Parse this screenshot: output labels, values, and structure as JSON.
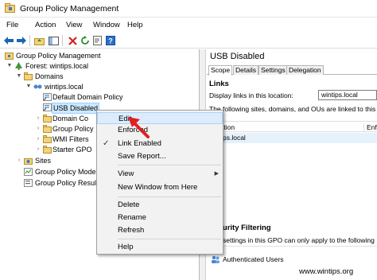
{
  "window": {
    "title": "Group Policy Management"
  },
  "menu": [
    "File",
    "Action",
    "View",
    "Window",
    "Help"
  ],
  "toolbar": {
    "icons": [
      "back-arrow-icon",
      "forward-arrow-icon",
      "up-folder-icon",
      "show-hide-tree-icon",
      "delete-x-icon",
      "refresh-icon",
      "export-icon",
      "help-icon"
    ]
  },
  "tree": {
    "root": "Group Policy Management",
    "forest": "Forest: wintips.local",
    "domains": "Domains",
    "domain": "wintips.local",
    "default_policy": "Default Domain Policy",
    "selected": "USB Disabled",
    "domain_controllers": "Domain Co",
    "group_policy_objects": "Group Policy",
    "wmi_filters": "WMI Filters",
    "starter_gpos": "Starter GPO",
    "sites": "Sites",
    "modeling": "Group Policy Modeli",
    "results": "Group Policy Resul"
  },
  "right": {
    "title": "USB Disabled",
    "tabs": [
      "Scope",
      "Details",
      "Settings",
      "Delegation"
    ],
    "links_heading": "Links",
    "display_links_label": "Display links in this location:",
    "location_value": "wintips.local",
    "linked_text": "The following sites, domains, and OUs are linked to this GPO:",
    "col_location": "Location",
    "col_enforced": "Enfo",
    "row_location": "wintips.local",
    "filter_heading": "Security Filtering",
    "filter_text": "The settings in this GPO can only apply to the following",
    "filter_row": "Authenticated Users"
  },
  "context_menu": {
    "items": {
      "edit": "Edit...",
      "enforced": "Enforced",
      "link_enabled": "Link Enabled",
      "save_report": "Save Report...",
      "view": "View",
      "new_window": "New Window from Here",
      "delete": "Delete",
      "rename": "Rename",
      "refresh": "Refresh",
      "help": "Help"
    },
    "link_enabled_checked": true
  },
  "watermark": "www.wintips.org",
  "colors": {
    "selection": "#cce8ff",
    "hover": "#dcecfc",
    "annotation_arrow": "#e02020"
  }
}
